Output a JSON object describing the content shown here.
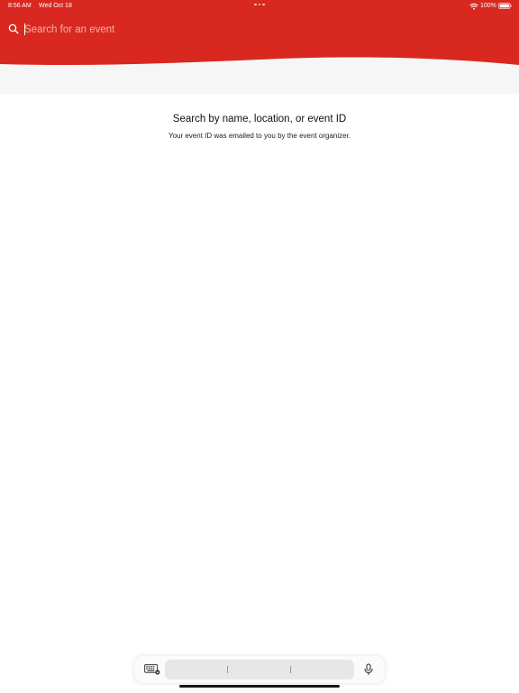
{
  "status_bar": {
    "time": "8:56 AM",
    "date": "Wed Oct 18",
    "battery": "100%",
    "icons": [
      "multitasking-dots-icon",
      "wifi-icon",
      "battery-icon"
    ]
  },
  "search": {
    "placeholder": "Search for an event",
    "value": "",
    "icon": "search-icon"
  },
  "empty_state": {
    "title": "Search by name, location, or event ID",
    "subtitle": "Your event ID was emailed to you by the event organizer."
  },
  "keyboard_bar": {
    "icons": [
      "keyboard-icon",
      "microphone-icon"
    ],
    "suggestions": [
      "",
      "",
      ""
    ]
  },
  "colors": {
    "brand": "#d9281f",
    "background": "#ffffff",
    "band": "#f6f6f6"
  }
}
